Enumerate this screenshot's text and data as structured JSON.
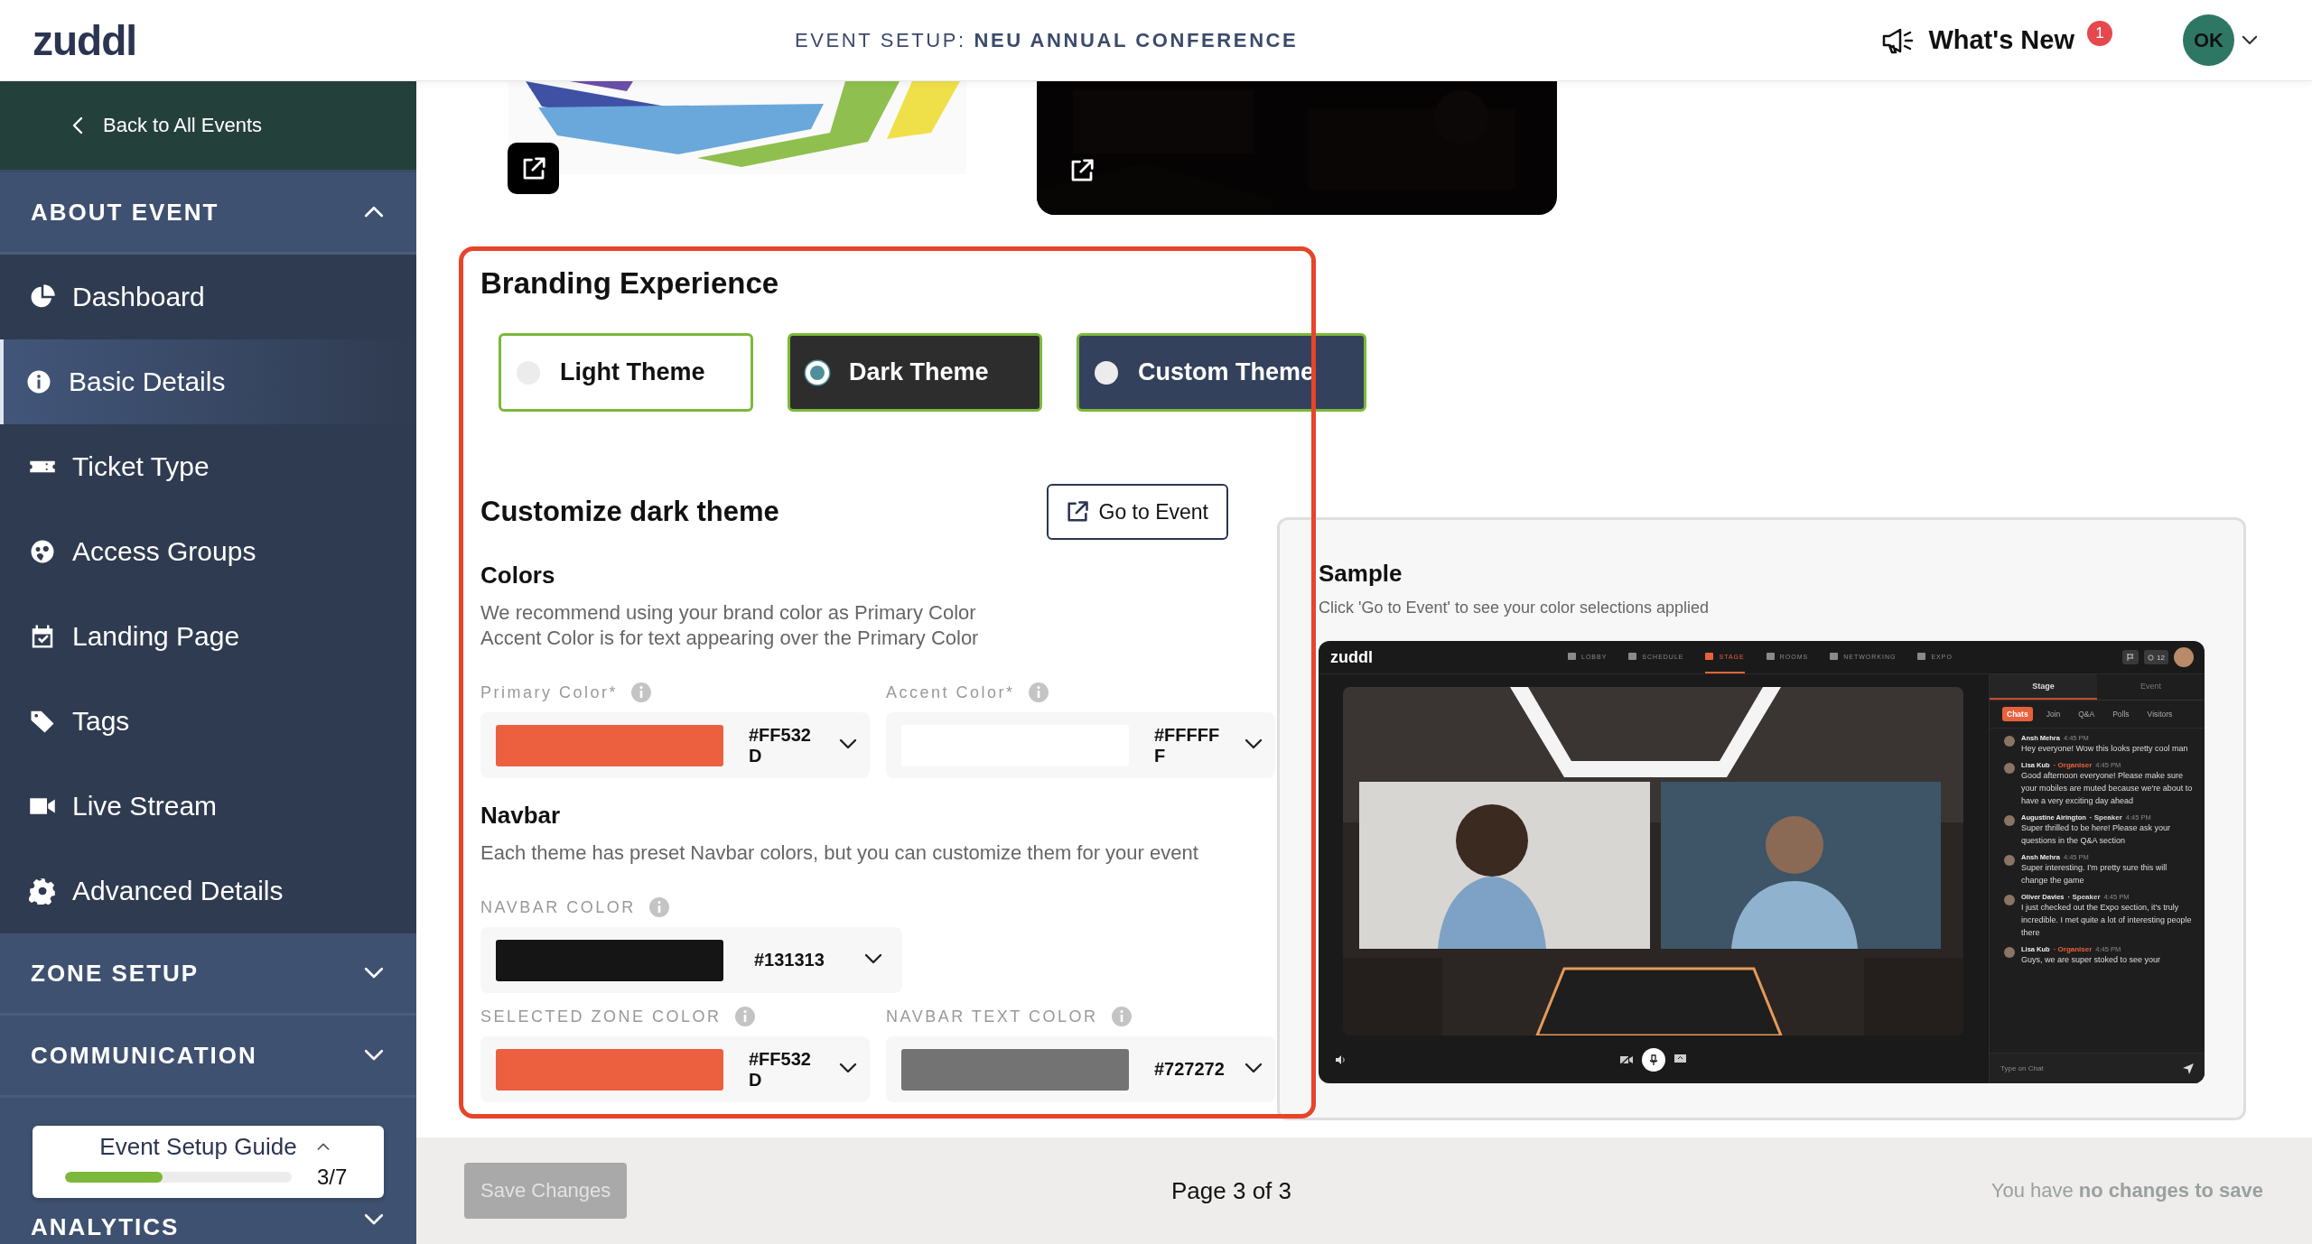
{
  "header": {
    "logo": "zuddl",
    "title": "EVENT SETUP: **NEU ANNUAL CONFERENCE**",
    "whats_new": "What's New",
    "badge": "1",
    "avatar": "OK"
  },
  "sidebar": {
    "back": "Back to All Events",
    "sections": [
      {
        "title": "ABOUT EVENT",
        "expanded": true,
        "items": [
          {
            "label": "Dashboard",
            "selected": false
          },
          {
            "label": "Basic Details",
            "selected": true
          },
          {
            "label": "Ticket Type",
            "selected": false
          },
          {
            "label": "Access Groups",
            "selected": false
          },
          {
            "label": "Landing Page",
            "selected": false
          },
          {
            "label": "Tags",
            "selected": false
          },
          {
            "label": "Live Stream",
            "selected": false
          },
          {
            "label": "Advanced Details",
            "selected": false
          }
        ]
      },
      {
        "title": "ZONE SETUP",
        "expanded": false
      },
      {
        "title": "COMMUNICATION",
        "expanded": false
      },
      {
        "title": "ANALYTICS",
        "expanded": false
      }
    ],
    "guide": {
      "title": "Event Setup Guide",
      "level": 0.43,
      "count": "3/7"
    }
  },
  "branding": {
    "title": "Branding Experience",
    "themes": [
      {
        "label": "Light Theme",
        "kind": "light",
        "selected": false
      },
      {
        "label": "Dark Theme",
        "kind": "dark",
        "selected": true
      },
      {
        "label": "Custom Theme",
        "kind": "custom",
        "selected": false
      }
    ]
  },
  "customize": {
    "title": "Customize dark theme",
    "button": "Go to Event",
    "colors": {
      "title": "Colors",
      "description": [
        "We recommend using your brand color as Primary Color",
        "Accent Color is for text appearing over the Primary Color"
      ],
      "fields": [
        {
          "label": "Primary Color*",
          "value": "#FF532D",
          "color": "#ec6040"
        },
        {
          "label": "Accent Color*",
          "value": "#FFFFFF",
          "color": "#ffffff"
        }
      ]
    },
    "navbar": {
      "title": "Navbar",
      "description": "Each theme has preset Navbar colors, but you can customize them for your event",
      "fields": [
        {
          "label": "NAVBAR COLOR",
          "value": "#131313",
          "color": "#151515"
        },
        {
          "label": "SELECTED ZONE COLOR",
          "value": "#FF532D",
          "color": "#ec6040"
        },
        {
          "label": "NAVBAR TEXT COLOR",
          "value": "#727272",
          "color": "#737373"
        }
      ]
    }
  },
  "sample": {
    "title": "Sample",
    "subtitle": "Click 'Go to Event' to see your color selections applied",
    "preview": {
      "logo": "zuddl",
      "nav": [
        {
          "label": "LOBBY",
          "selected": false
        },
        {
          "label": "SCHEDULE",
          "selected": false
        },
        {
          "label": "STAGE",
          "selected": true
        },
        {
          "label": "ROOMS",
          "selected": false
        },
        {
          "label": "NETWORKING",
          "selected": false
        },
        {
          "label": "EXPO",
          "selected": false
        }
      ],
      "count": "12",
      "tabs": [
        {
          "label": "Stage",
          "selected": true
        },
        {
          "label": "Event",
          "selected": false
        }
      ],
      "chat_tabs": [
        {
          "label": "Chats",
          "selected": true
        },
        {
          "label": "Join",
          "selected": false
        },
        {
          "label": "Q&A",
          "selected": false
        },
        {
          "label": "Polls",
          "selected": false
        },
        {
          "label": "Visitors",
          "selected": false
        }
      ],
      "messages": [
        {
          "name": "Ansh Mehra",
          "time": "4:45 PM",
          "text": "Hey everyone! Wow this looks pretty cool man"
        },
        {
          "name": "Lisa Kub",
          "role": "· Organiser",
          "kind": "organiser",
          "time": "4:45 PM",
          "text": "Good afternoon everyone! Please make sure your mobiles are muted because we're about to have a very exciting day ahead"
        },
        {
          "name": "Augustine Airington",
          "role": "· Speaker",
          "kind": "speaker",
          "time": "4:45 PM",
          "text": "Super thrilled to be here! Please ask your questions in the Q&A section"
        },
        {
          "name": "Ansh Mehra",
          "time": "4:45 PM",
          "text": "Super interesting. I'm pretty sure this will change the game"
        },
        {
          "name": "Oliver Davies",
          "role": "· Speaker",
          "kind": "speaker",
          "time": "4:45 PM",
          "text": "I just checked out the Expo section, it's truly incredible. I met quite a lot of interesting people there"
        },
        {
          "name": "Lisa Kub",
          "role": "· Organiser",
          "kind": "organiser",
          "time": "4:45 PM",
          "text": "Guys, we are super stoked to see your"
        }
      ],
      "placeholder": "Type on Chat"
    }
  },
  "footer": {
    "save": "Save Changes",
    "save_disabled": true,
    "page": "Page 3 of 3",
    "status": "You have **no changes to save**"
  }
}
